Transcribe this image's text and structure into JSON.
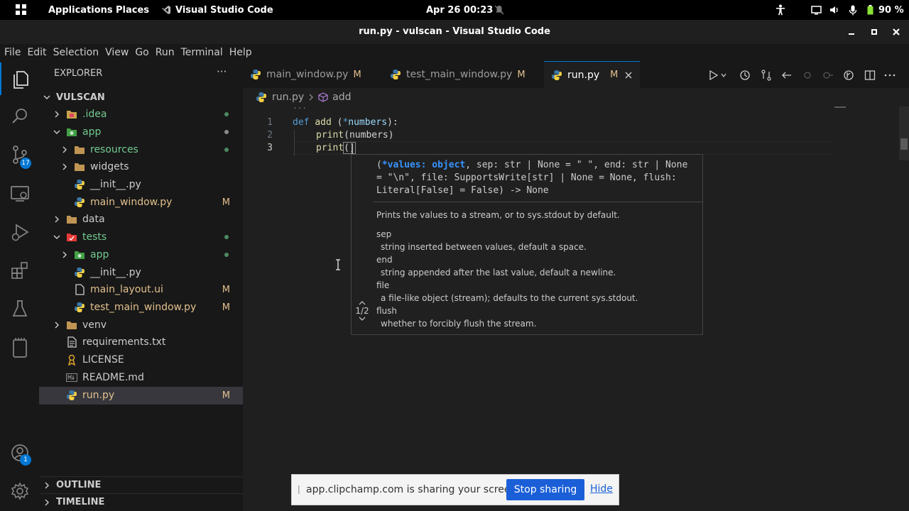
{
  "topbar": {
    "applications": "Applications",
    "places": "Places",
    "app_name": "Visual Studio Code",
    "datetime": "Apr 26  00:23",
    "battery": "90 %"
  },
  "window": {
    "title": "run.py - vulscan - Visual Studio Code"
  },
  "menubar": [
    "File",
    "Edit",
    "Selection",
    "View",
    "Go",
    "Run",
    "Terminal",
    "Help"
  ],
  "activitybar": {
    "scm_badge": "17",
    "accounts_badge": "1"
  },
  "sidebar": {
    "header": "EXPLORER",
    "more": "···",
    "root": "VULSCAN",
    "items": [
      {
        "label": ".idea",
        "status": ""
      },
      {
        "label": "app",
        "status": ""
      },
      {
        "label": "resources",
        "status": ""
      },
      {
        "label": "widgets",
        "status": ""
      },
      {
        "label": "__init__.py",
        "status": ""
      },
      {
        "label": "main_window.py",
        "status": "M"
      },
      {
        "label": "data",
        "status": ""
      },
      {
        "label": "tests",
        "status": ""
      },
      {
        "label": "app",
        "status": ""
      },
      {
        "label": "__init__.py",
        "status": ""
      },
      {
        "label": "main_layout.ui",
        "status": "M"
      },
      {
        "label": "test_main_window.py",
        "status": "M"
      },
      {
        "label": "venv",
        "status": ""
      },
      {
        "label": "requirements.txt",
        "status": ""
      },
      {
        "label": "LICENSE",
        "status": ""
      },
      {
        "label": "README.md",
        "status": ""
      },
      {
        "label": "run.py",
        "status": "M"
      }
    ],
    "outline": "OUTLINE",
    "timeline": "TIMELINE"
  },
  "tabs": [
    {
      "label": "main_window.py",
      "mod": "M"
    },
    {
      "label": "test_main_window.py",
      "mod": "M"
    },
    {
      "label": "run.py",
      "mod": "M"
    }
  ],
  "breadcrumb": {
    "file": "run.py",
    "symbol": "add"
  },
  "editor": {
    "line_numbers": [
      "1",
      "2",
      "3"
    ],
    "line1": {
      "kw": "def",
      "fn": "add",
      "rest_open": " (",
      "star": "*",
      "param": "numbers",
      "rest_close": "):"
    },
    "line2": {
      "fn": "print",
      "args": "(numbers)"
    },
    "line3": {
      "fn": "print",
      "args": "()"
    },
    "folded": "···"
  },
  "hover": {
    "signature_params": "*values: object",
    "signature_rest": ", sep: str | None = \" \", end: str | None = \"\\n\", file: SupportsWrite[str] | None = None, flush: Literal[False] = False) -> None",
    "signature_open": "(",
    "description": "Prints the values to a stream, or to sys.stdout by default.",
    "params": [
      {
        "name": "sep",
        "desc": "string inserted between values, default a space."
      },
      {
        "name": "end",
        "desc": "string appended after the last value, default a newline."
      },
      {
        "name": "file",
        "desc": "a file-like object (stream); defaults to the current sys.stdout."
      },
      {
        "name": "flush",
        "desc": "whether to forcibly flush the stream."
      }
    ],
    "overload": "1/2"
  },
  "sharebar": {
    "message": "app.clipchamp.com is sharing your screen.",
    "stop": "Stop sharing",
    "hide": "Hide"
  }
}
